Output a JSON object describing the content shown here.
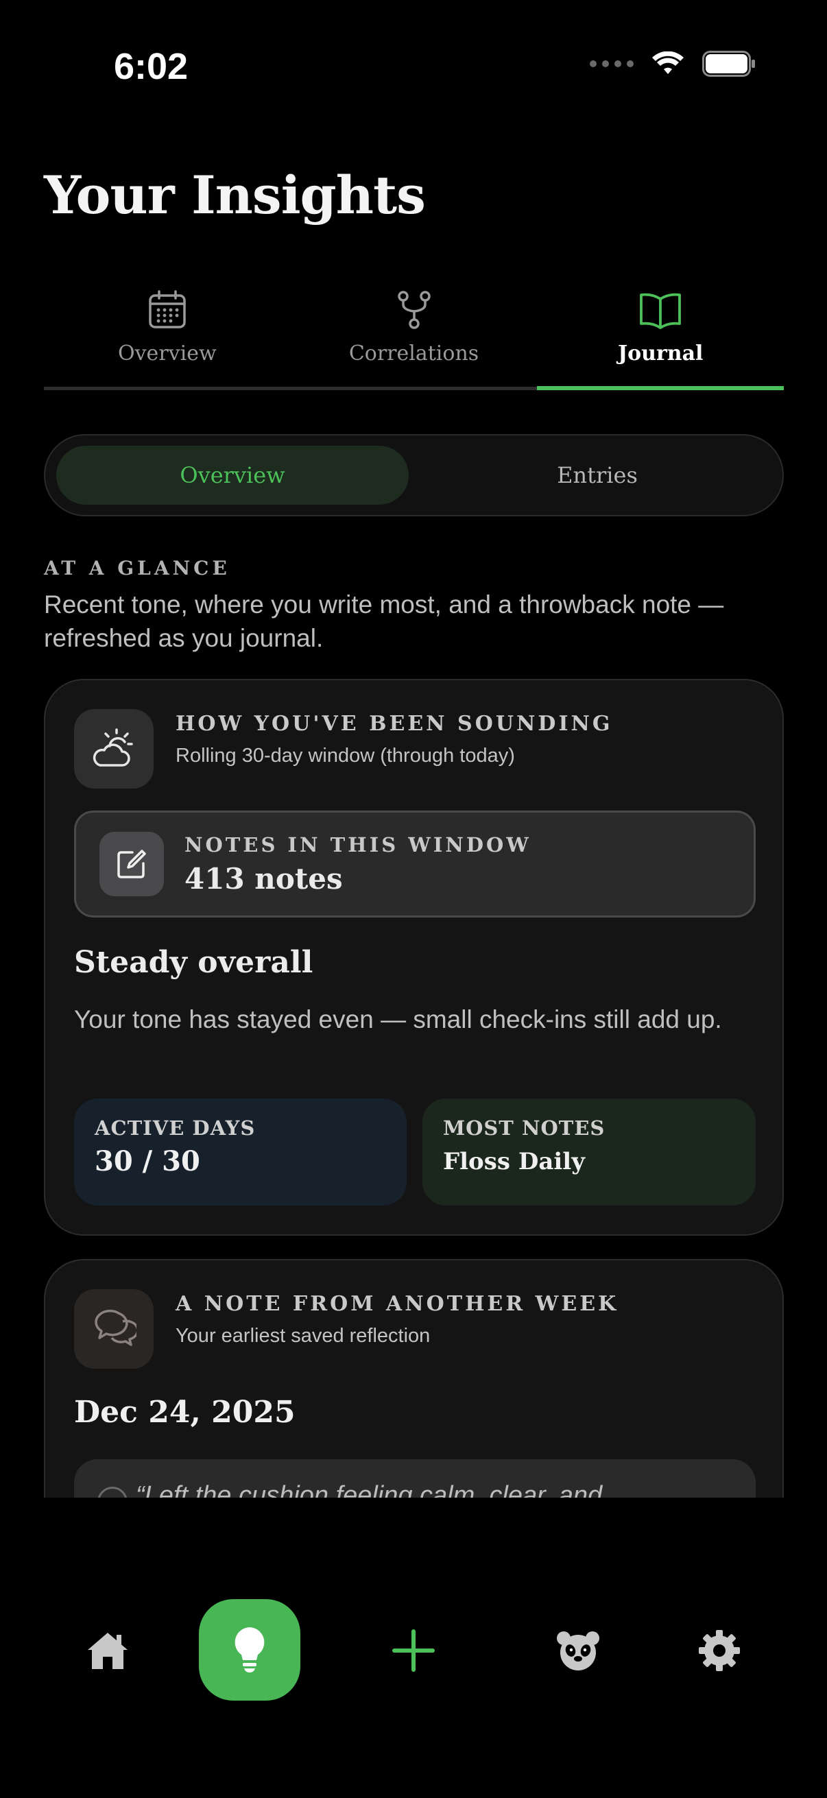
{
  "status_bar": {
    "time": "6:02"
  },
  "header": {
    "title": "Your Insights"
  },
  "tabs": [
    {
      "label": "Overview",
      "icon": "calendar-icon"
    },
    {
      "label": "Correlations",
      "icon": "branch-icon"
    },
    {
      "label": "Journal",
      "icon": "book-icon",
      "active": true
    }
  ],
  "segmented": {
    "overview_label": "Overview",
    "entries_label": "Entries",
    "selected": "Overview"
  },
  "at_a_glance": {
    "heading": "AT A GLANCE",
    "description": "Recent tone, where you write most, and a throwback note — refreshed as you journal."
  },
  "sounding_card": {
    "icon": "partly-cloudy-icon",
    "kicker": "HOW YOU'VE BEEN SOUNDING",
    "subtitle": "Rolling 30-day window (through today)",
    "notes_label": "NOTES IN THIS WINDOW",
    "notes_value": "413 notes",
    "summary_title": "Steady overall",
    "summary_text": "Your tone has stayed even — small check-ins still add up.",
    "active_days_label": "ACTIVE DAYS",
    "active_days_value": "30 / 30",
    "most_notes_label": "MOST NOTES",
    "most_notes_value": "Floss Daily"
  },
  "throwback_card": {
    "icon": "chat-bubbles-icon",
    "kicker": "A NOTE FROM ANOTHER WEEK",
    "subtitle": "Your earliest saved reflection",
    "date": "Dec 24, 2025",
    "quote": "“Left the cushion feeling calm, clear, and"
  },
  "bottom_nav": [
    {
      "name": "home",
      "icon": "home-icon"
    },
    {
      "name": "insights",
      "icon": "lightbulb-icon",
      "active": true
    },
    {
      "name": "add",
      "icon": "plus-icon"
    },
    {
      "name": "panda",
      "icon": "panda-icon"
    },
    {
      "name": "settings",
      "icon": "gear-icon"
    }
  ],
  "colors": {
    "accent": "#4cc15a",
    "background": "#000000",
    "card": "#141414",
    "stat_blue": "#16212b",
    "stat_green": "#1b261c"
  }
}
